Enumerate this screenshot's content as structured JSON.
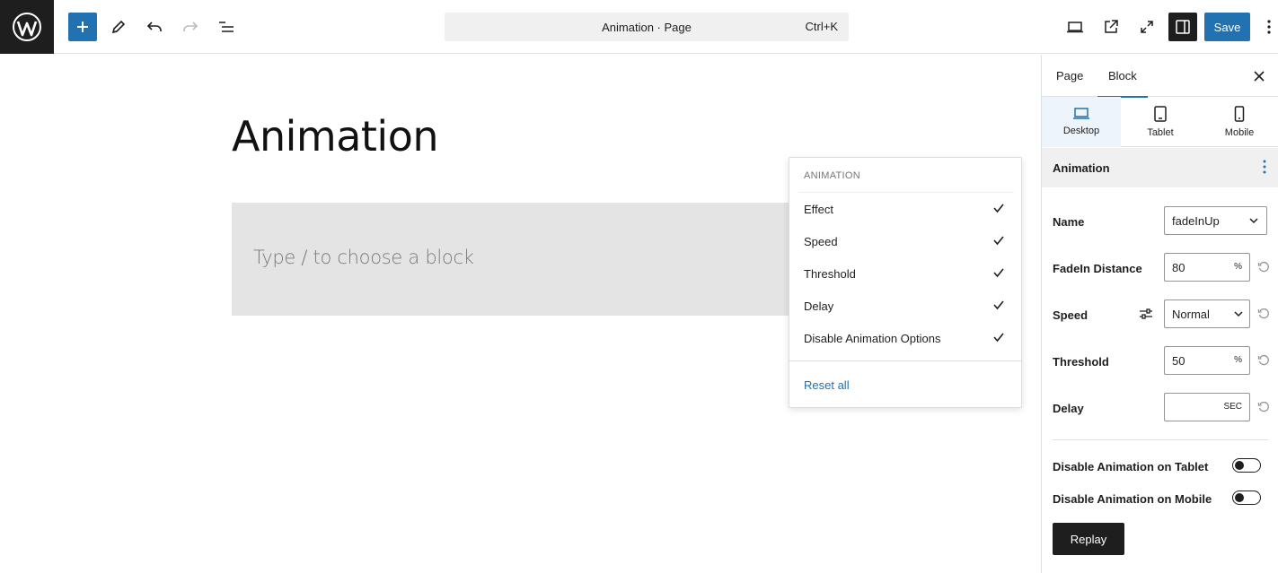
{
  "toolbar": {
    "command_title": "Animation · Page",
    "command_shortcut": "Ctrl+K",
    "save_label": "Save"
  },
  "canvas": {
    "page_title": "Animation",
    "block_placeholder": "Type / to choose a block"
  },
  "popover": {
    "heading": "ANIMATION",
    "items": [
      {
        "label": "Effect",
        "checked": true
      },
      {
        "label": "Speed",
        "checked": true
      },
      {
        "label": "Threshold",
        "checked": true
      },
      {
        "label": "Delay",
        "checked": true
      },
      {
        "label": "Disable Animation Options",
        "checked": true
      }
    ],
    "reset_label": "Reset all"
  },
  "sidebar": {
    "tabs": [
      {
        "label": "Page",
        "active": false
      },
      {
        "label": "Block",
        "active": true
      }
    ],
    "devices": [
      {
        "label": "Desktop",
        "icon": "desktop-icon",
        "active": true
      },
      {
        "label": "Tablet",
        "icon": "tablet-icon",
        "active": false
      },
      {
        "label": "Mobile",
        "icon": "mobile-icon",
        "active": false
      }
    ],
    "panel_title": "Animation",
    "fields": {
      "name": {
        "label": "Name",
        "value": "fadeInUp"
      },
      "fadein_distance": {
        "label": "FadeIn Distance",
        "value": "80",
        "unit": "%"
      },
      "speed": {
        "label": "Speed",
        "value": "Normal"
      },
      "threshold": {
        "label": "Threshold",
        "value": "50",
        "unit": "%"
      },
      "delay": {
        "label": "Delay",
        "value": "",
        "unit": "SEC"
      }
    },
    "toggles": [
      {
        "label": "Disable Animation on Tablet",
        "on": false
      },
      {
        "label": "Disable Animation on Mobile",
        "on": false
      }
    ],
    "replay_label": "Replay"
  },
  "colors": {
    "accent": "#2271b1",
    "dark": "#1e1e1e"
  }
}
